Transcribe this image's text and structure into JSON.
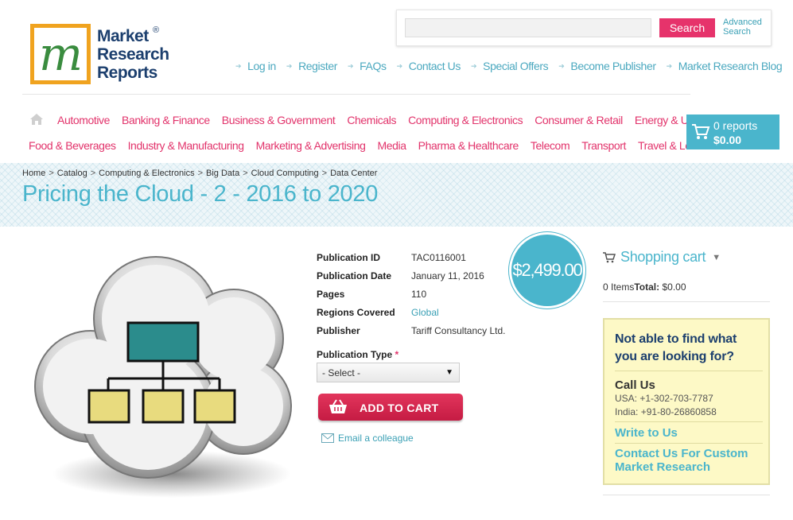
{
  "logo": {
    "line1": "Market",
    "line2": "Research",
    "line3": "Reports",
    "reg": "®"
  },
  "search": {
    "placeholder": "",
    "button_label": "Search",
    "advanced_line1": "Advanced",
    "advanced_line2": "Search"
  },
  "top_links": [
    "Log in",
    "Register",
    "FAQs",
    "Contact Us",
    "Special Offers",
    "Become Publisher",
    "Market Research Blog"
  ],
  "categories_row1": [
    "Automotive",
    "Banking & Finance",
    "Business & Government",
    "Chemicals",
    "Computing & Electronics",
    "Consumer & Retail",
    "Energy & Utilities"
  ],
  "categories_row2": [
    "Food & Beverages",
    "Industry & Manufacturing",
    "Marketing & Advertising",
    "Media",
    "Pharma & Healthcare",
    "Telecom",
    "Transport",
    "Travel & Leisure"
  ],
  "cart_button": {
    "reports": "0 reports",
    "amount": "$0.00"
  },
  "breadcrumb": [
    "Home",
    "Catalog",
    "Computing & Electronics",
    "Big Data",
    "Cloud Computing",
    "Data Center"
  ],
  "page_title": "Pricing the Cloud - 2 - 2016 to 2020",
  "details": {
    "publication_id": {
      "label": "Publication ID",
      "value": "TAC0116001"
    },
    "publication_date": {
      "label": "Publication Date",
      "value": "January 11, 2016"
    },
    "pages": {
      "label": "Pages",
      "value": "110"
    },
    "regions": {
      "label": "Regions Covered",
      "value": "Global"
    },
    "publisher": {
      "label": "Publisher",
      "value": "Tariff Consultancy Ltd."
    }
  },
  "price": "$2,499.00",
  "publication_type": {
    "label": "Publication Type",
    "required": "*",
    "selected": "- Select -"
  },
  "add_to_cart_label": "ADD TO CART",
  "email_colleague": "Email a colleague",
  "shopping_cart": {
    "title": "Shopping cart",
    "items": "0 Items",
    "total_label": "Total:",
    "total_value": " $0.00"
  },
  "help_box": {
    "title_line1": "Not able to find what",
    "title_line2": "you are looking for?",
    "call_us": "Call Us",
    "usa": "USA: +1-302-703-7787",
    "india": "India: +91-80-26860858",
    "write_us": "Write to Us",
    "custom_line1": "Contact Us For Custom",
    "custom_line2": "Market Research"
  },
  "colors": {
    "accent": "#4ab5cc",
    "pink": "#e2336b",
    "navy": "#1c3f6e",
    "logo_orange": "#f0a31f"
  }
}
